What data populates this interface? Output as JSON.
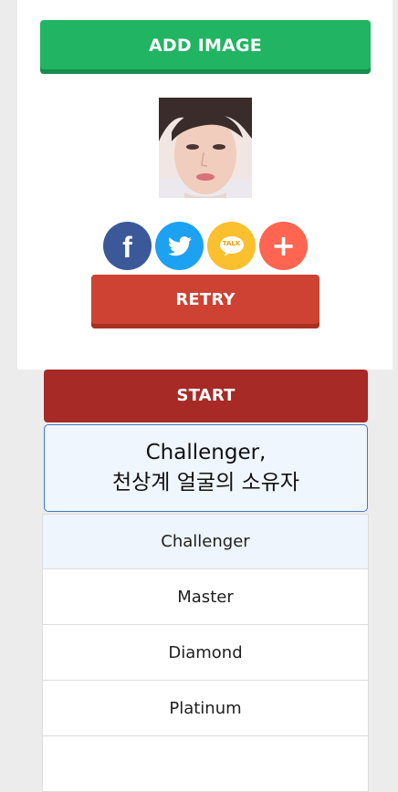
{
  "buttons": {
    "add_image": "ADD IMAGE",
    "retry": "RETRY",
    "start": "START"
  },
  "share": [
    {
      "name": "facebook",
      "label": "f",
      "color": "#3b5998"
    },
    {
      "name": "twitter",
      "color": "#1da1f2"
    },
    {
      "name": "kakaotalk",
      "label": "TALK",
      "color": "#fbc02d"
    },
    {
      "name": "more",
      "label": "+",
      "color": "#ff6550"
    }
  ],
  "result": {
    "line1": "Challenger,",
    "line2": "천상계 얼굴의 소유자"
  },
  "tiers": [
    "Challenger",
    "Master",
    "Diamond",
    "Platinum",
    ""
  ],
  "colors": {
    "add_image": "#21b462",
    "retry": "#cd4232",
    "start": "#a72a26",
    "result_border": "#3f78c5",
    "active_tier_bg": "#eef5fc"
  }
}
